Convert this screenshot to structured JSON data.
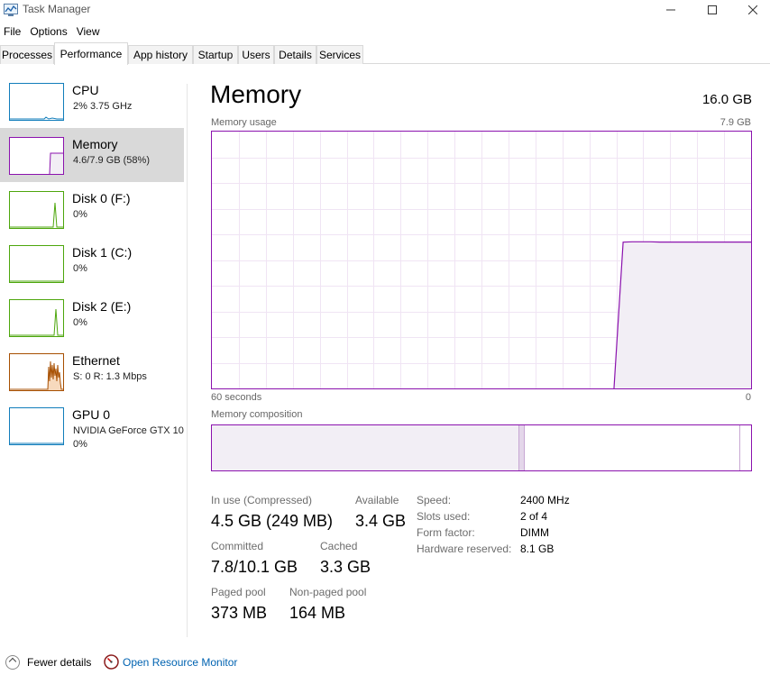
{
  "window": {
    "title": "Task Manager",
    "minimize_icon": "minimize-icon",
    "maximize_icon": "maximize-icon",
    "close_icon": "close-icon"
  },
  "menu": [
    "File",
    "Options",
    "View"
  ],
  "tabs": [
    "Processes",
    "Performance",
    "App history",
    "Startup",
    "Users",
    "Details",
    "Services"
  ],
  "active_tab": "Performance",
  "sidebar": [
    {
      "name": "CPU",
      "sub": "2%  3.75 GHz",
      "color": "#117dbb"
    },
    {
      "name": "Memory",
      "sub": "4.6/7.9 GB (58%)",
      "color": "#8b12ae",
      "selected": true
    },
    {
      "name": "Disk 0 (F:)",
      "sub": "0%",
      "color": "#4da60c"
    },
    {
      "name": "Disk 1 (C:)",
      "sub": "0%",
      "color": "#4da60c"
    },
    {
      "name": "Disk 2 (E:)",
      "sub": "0%",
      "color": "#4da60c"
    },
    {
      "name": "Ethernet",
      "sub": "S: 0  R: 1.3 Mbps",
      "color": "#a74f01"
    },
    {
      "name": "GPU 0",
      "sub": "NVIDIA GeForce GTX 10",
      "sub2": "0%",
      "color": "#117dbb"
    }
  ],
  "main": {
    "title": "Memory",
    "total": "16.0 GB",
    "usage_label": "Memory usage",
    "usage_max": "7.9 GB",
    "time_left": "60 seconds",
    "time_right": "0",
    "composition_label": "Memory composition",
    "accent_color": "#8b12ae"
  },
  "chart_data": {
    "type": "area",
    "x_range_seconds": [
      60,
      0
    ],
    "ylim_gb": [
      0,
      7.9
    ],
    "grid": true,
    "series": [
      {
        "values_gb": [
          0,
          0,
          0,
          0,
          0,
          0,
          0,
          0,
          0,
          0,
          0,
          0,
          0,
          0,
          0,
          0,
          0,
          0,
          0,
          0,
          0,
          0,
          0,
          0,
          0,
          0,
          0,
          0,
          0,
          0,
          0,
          0,
          0,
          0,
          0,
          0,
          0,
          0,
          0,
          0,
          0,
          0,
          0,
          0,
          0,
          4.5,
          4.51,
          4.51,
          4.51,
          4.5,
          4.5,
          4.5,
          4.5,
          4.5,
          4.5,
          4.5,
          4.5,
          4.5,
          4.5,
          4.5
        ]
      }
    ],
    "composition_fractions": {
      "in_use": 0.57,
      "modified": 0.01,
      "standby": 0.4,
      "free": 0.02
    }
  },
  "stats": {
    "in_use_label": "In use (Compressed)",
    "in_use_value": "4.5 GB (249 MB)",
    "available_label": "Available",
    "available_value": "3.4 GB",
    "committed_label": "Committed",
    "committed_value": "7.8/10.1 GB",
    "cached_label": "Cached",
    "cached_value": "3.3 GB",
    "paged_label": "Paged pool",
    "paged_value": "373 MB",
    "nonpaged_label": "Non-paged pool",
    "nonpaged_value": "164 MB"
  },
  "specs": [
    {
      "label": "Speed:",
      "value": "2400 MHz"
    },
    {
      "label": "Slots used:",
      "value": "2 of 4"
    },
    {
      "label": "Form factor:",
      "value": "DIMM"
    },
    {
      "label": "Hardware reserved:",
      "value": "8.1 GB"
    }
  ],
  "footer": {
    "fewer_details": "Fewer details",
    "fewer_icon": "chevron-up-icon",
    "open_resource_monitor": "Open Resource Monitor",
    "resource_monitor_icon": "resource-monitor-icon"
  }
}
